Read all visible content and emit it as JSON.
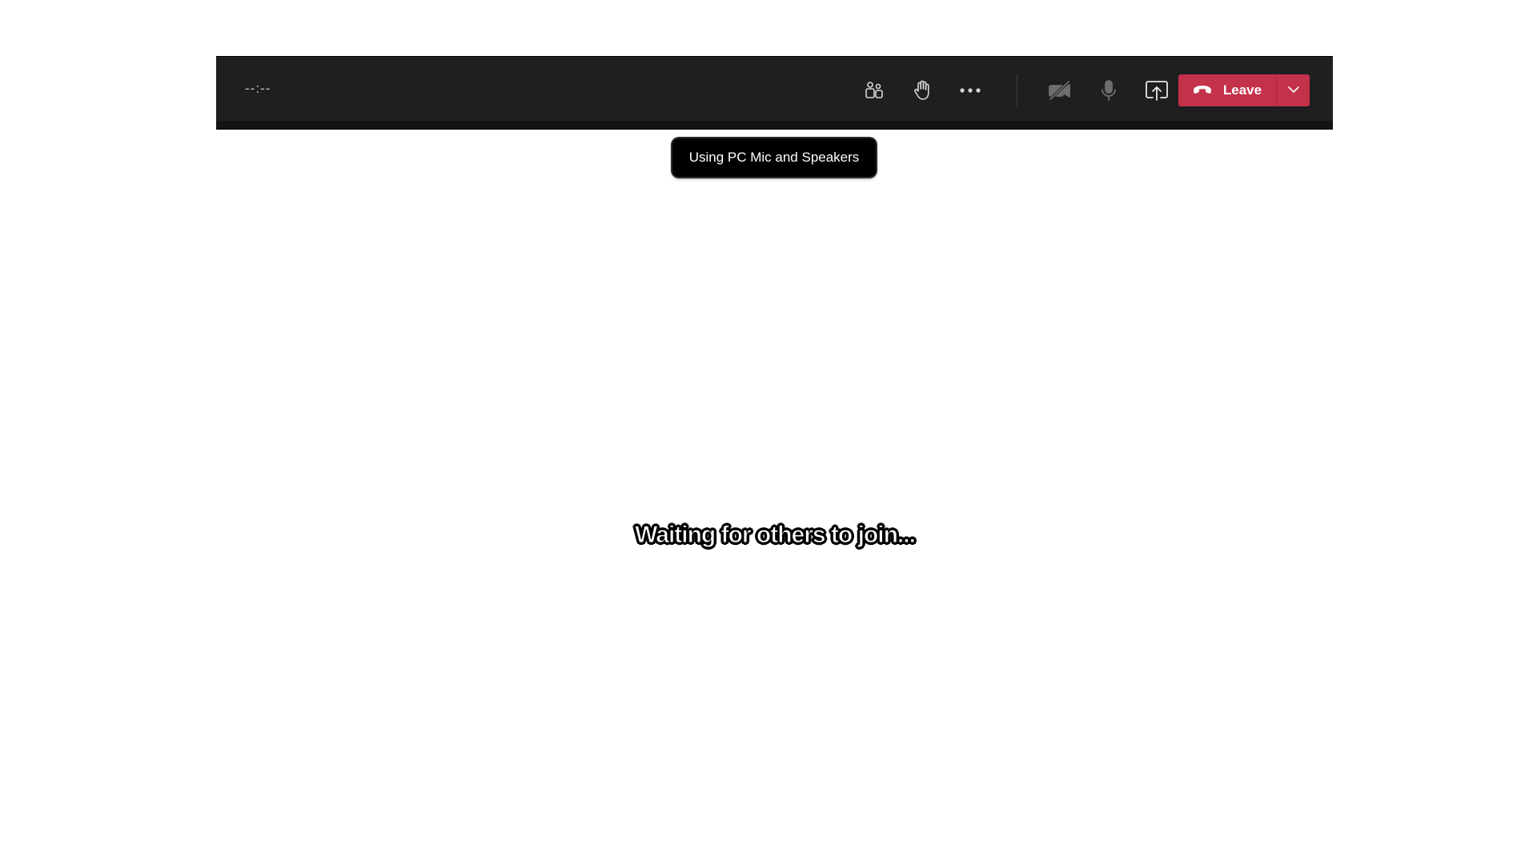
{
  "meeting": {
    "timer": "--:--",
    "status_message": "Waiting for others to join..."
  },
  "toolbar": {
    "participants_icon": "people-icon",
    "raise_hand_icon": "raise-hand-icon",
    "more_icon": "more-options-icon",
    "camera_icon": "camera-off-icon",
    "mic_icon": "microphone-icon",
    "share_icon": "share-screen-icon",
    "leave_icon": "hang-up-icon",
    "leave_label": "Leave",
    "leave_options_icon": "chevron-down-icon"
  },
  "tooltip": {
    "text": "Using PC Mic and Speakers"
  },
  "colors": {
    "toolbar_bg": "#1f1f1f",
    "leave_red": "#c4314b",
    "accent": "#6264a7"
  }
}
